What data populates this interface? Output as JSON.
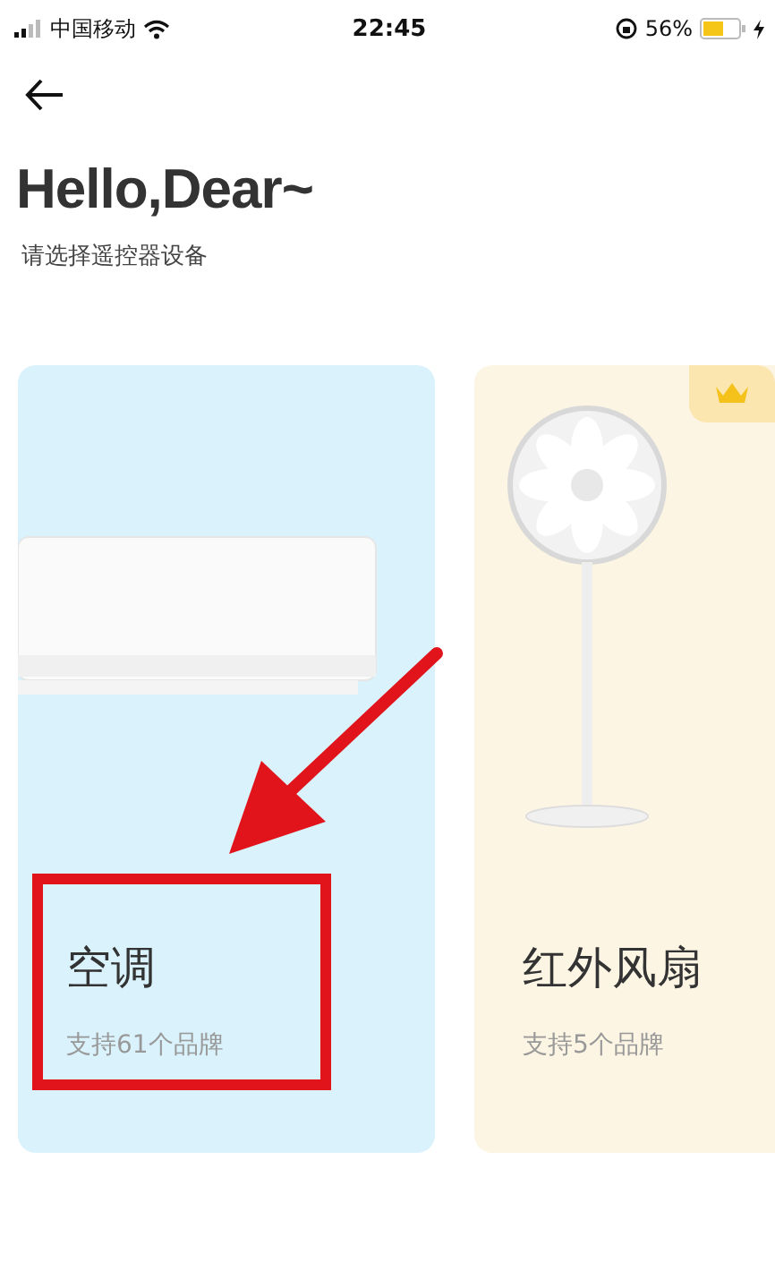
{
  "status_bar": {
    "carrier": "中国移动",
    "time": "22:45",
    "battery": "56%"
  },
  "header": {
    "title": "Hello,Dear~",
    "subtitle": "请选择遥控器设备"
  },
  "devices": [
    {
      "kind": "air-conditioner",
      "title": "空调",
      "subtitle": "支持61个品牌",
      "premium": false,
      "highlighted": true
    },
    {
      "kind": "fan",
      "title": "红外风扇",
      "subtitle": "支持5个品牌",
      "premium": true,
      "highlighted": false
    }
  ]
}
